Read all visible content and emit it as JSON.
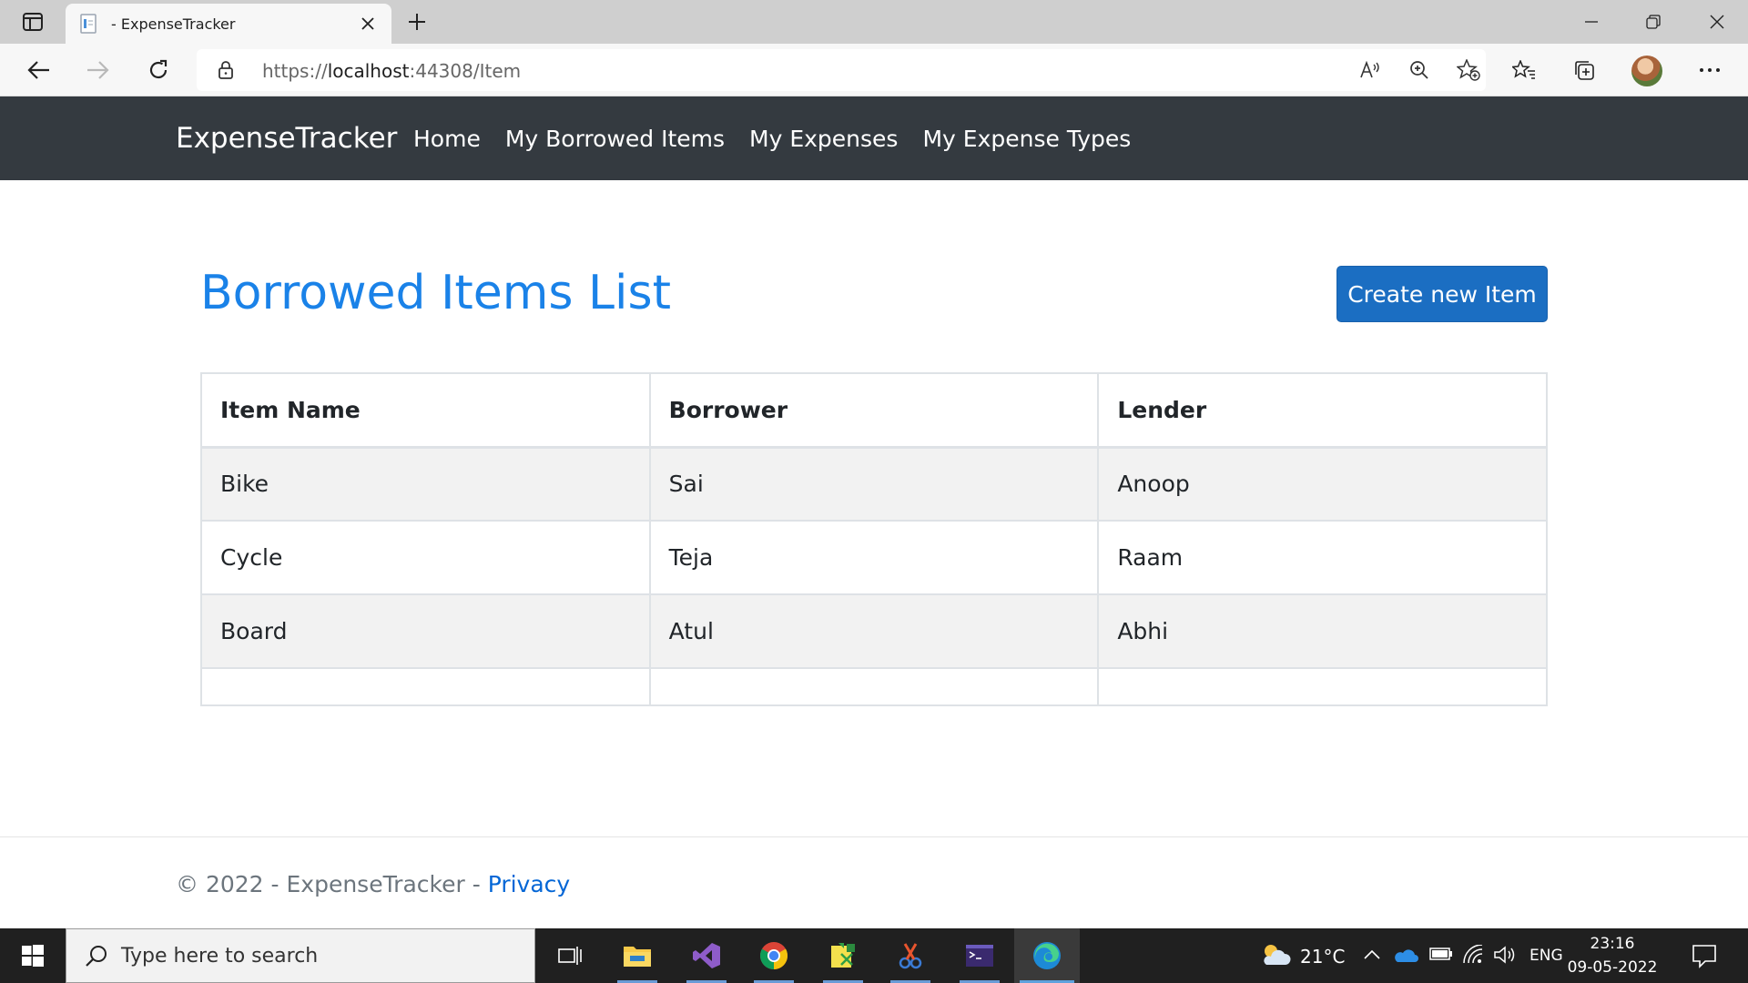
{
  "browser": {
    "tab_title": "- ExpenseTracker",
    "url_scheme": "https://",
    "url_host": "localhost",
    "url_path": ":44308/Item"
  },
  "site": {
    "brand": "ExpenseTracker",
    "nav": [
      "Home",
      "My Borrowed Items",
      "My Expenses",
      "My Expense Types"
    ]
  },
  "main": {
    "title": "Borrowed Items List",
    "create_button": "Create new Item",
    "table": {
      "headers": [
        "Item Name",
        "Borrower",
        "Lender"
      ],
      "rows": [
        [
          "Bike",
          "Sai",
          "Anoop"
        ],
        [
          "Cycle",
          "Teja",
          "Raam"
        ],
        [
          "Board",
          "Atul",
          "Abhi"
        ]
      ]
    }
  },
  "footer": {
    "copyright": "© 2022 - ExpenseTracker - ",
    "privacy": "Privacy"
  },
  "taskbar": {
    "search_placeholder": "Type here to search",
    "weather": "21°C",
    "language": "ENG",
    "time": "23:16",
    "date": "09-05-2022"
  },
  "colors": {
    "navbar": "#343a40",
    "title": "#1a82e8",
    "primary_button": "#1b6ec2",
    "link": "#0366d6"
  }
}
